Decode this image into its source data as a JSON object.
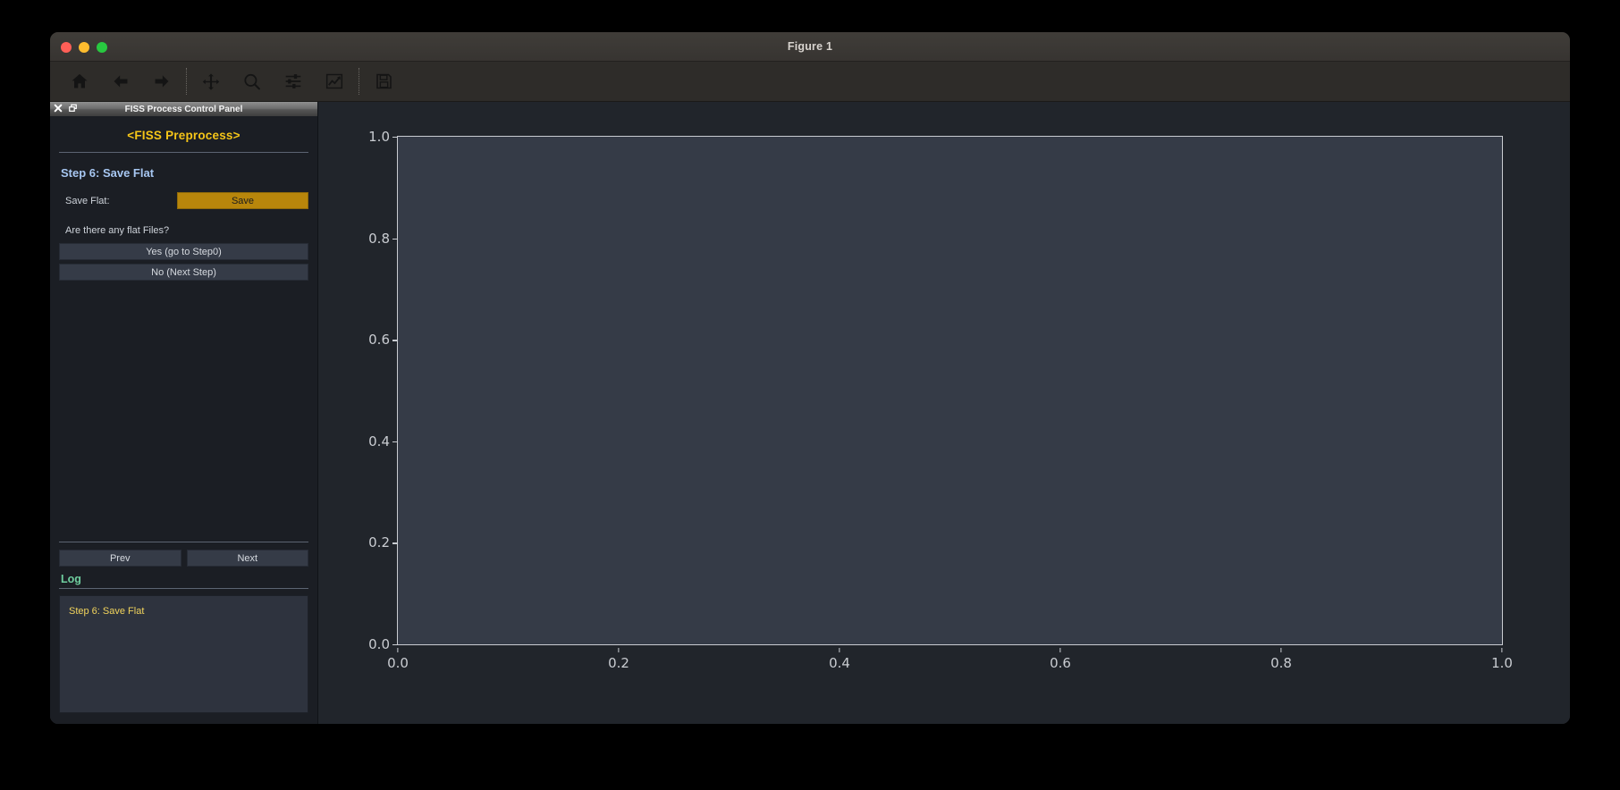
{
  "window": {
    "title": "Figure 1",
    "controls": [
      {
        "name": "close-window-button",
        "color": "#ff5f57"
      },
      {
        "name": "minimize-window-button",
        "color": "#febc2e"
      },
      {
        "name": "maximize-window-button",
        "color": "#28c840"
      }
    ]
  },
  "toolbar": {
    "buttons": [
      {
        "icon": "home-icon",
        "tooltip": "Home"
      },
      {
        "icon": "back-arrow-icon",
        "tooltip": "Back"
      },
      {
        "icon": "forward-arrow-icon",
        "tooltip": "Forward"
      },
      {
        "icon": "pan-move-icon",
        "tooltip": "Pan"
      },
      {
        "icon": "zoom-magnifier-icon",
        "tooltip": "Zoom"
      },
      {
        "icon": "subplot-sliders-icon",
        "tooltip": "Configure subplots"
      },
      {
        "icon": "edit-curve-chart-icon",
        "tooltip": "Edit axis, curve and image parameters"
      },
      {
        "icon": "save-floppy-icon",
        "tooltip": "Save the figure"
      }
    ]
  },
  "dock": {
    "title": "FISS Process Control Panel",
    "close_icon": "close-icon",
    "float_icon": "undock-window-icon"
  },
  "panel": {
    "heading": "<FISS Preprocess>",
    "step_title": "Step 6: Save Flat",
    "save_flat_label": "Save Flat:",
    "save_button_label": "Save",
    "question": "Are there any flat Files?",
    "yes_button_label": "Yes (go to Step0)",
    "no_button_label": "No (Next Step)",
    "prev_button_label": "Prev",
    "next_button_label": "Next",
    "log_title": "Log",
    "log_lines": [
      "Step 6: Save Flat"
    ],
    "colors": {
      "heading": "#f5c518",
      "step_title": "#a7c7f2",
      "save_button": "#b8860b",
      "log_title": "#6fce9f",
      "log_text": "#f2d45c"
    }
  },
  "chart_data": {
    "type": "line",
    "title": "",
    "xlabel": "",
    "ylabel": "",
    "xlim": [
      0.0,
      1.0
    ],
    "ylim": [
      0.0,
      1.0
    ],
    "xticks": [
      "0.0",
      "0.2",
      "0.4",
      "0.6",
      "0.8",
      "1.0"
    ],
    "xtick_values": [
      0.0,
      0.2,
      0.4,
      0.6,
      0.8,
      1.0
    ],
    "yticks": [
      "0.0",
      "0.2",
      "0.4",
      "0.6",
      "0.8",
      "1.0"
    ],
    "ytick_values": [
      0.0,
      0.2,
      0.4,
      0.6,
      0.8,
      1.0
    ],
    "series": [],
    "grid": false,
    "legend": false,
    "facecolor": "#353b47",
    "figure_facecolor": "#21252b"
  }
}
